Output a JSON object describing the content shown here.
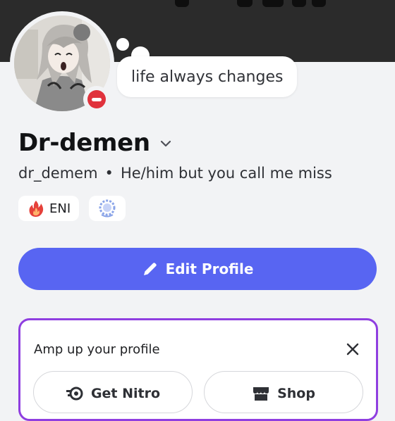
{
  "profile": {
    "display_name": "Dr-demen",
    "username": "dr_demem",
    "separator": "•",
    "pronouns": "He/him but you call me miss",
    "custom_status": "life always changes",
    "presence": "dnd"
  },
  "badges": [
    {
      "label": "ENI",
      "icon": "fire-icon"
    },
    {
      "label": "",
      "icon": "laurel-badge-icon"
    }
  ],
  "actions": {
    "edit_profile_label": "Edit Profile"
  },
  "amp_card": {
    "title": "Amp up your profile",
    "nitro_label": "Get Nitro",
    "shop_label": "Shop"
  },
  "colors": {
    "accent": "#5865f2",
    "nitro_border": "#8f3ee0",
    "dnd": "#e0323c",
    "banner": "#2b2b2b",
    "background": "#f2f3f5"
  }
}
